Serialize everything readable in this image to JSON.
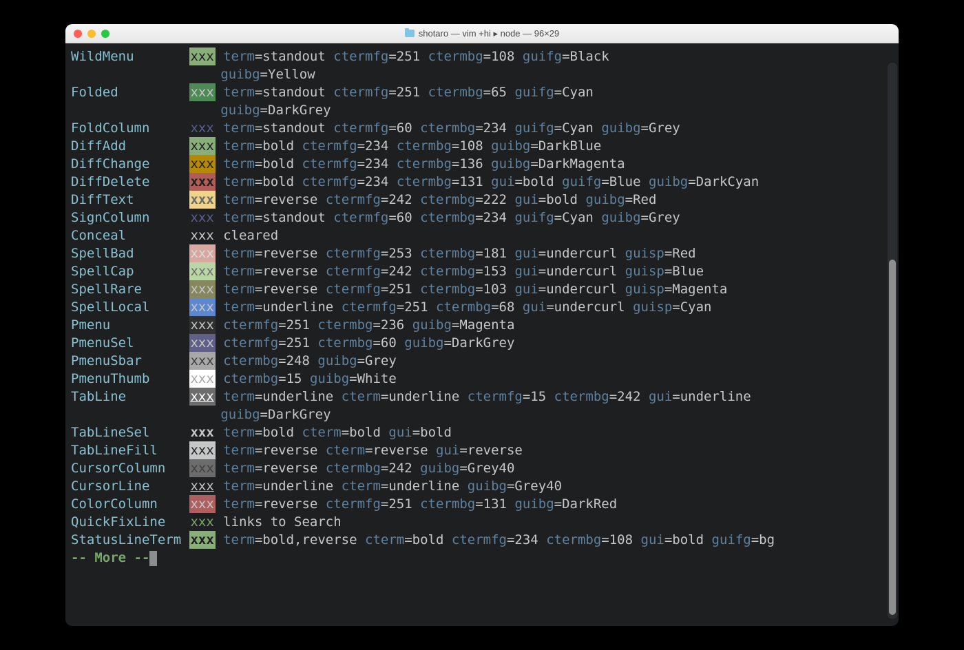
{
  "window": {
    "title": "shotaro — vim +hi ▸ node — 96×29"
  },
  "more_prompt": "-- More --",
  "pad": 14,
  "groups": [
    {
      "name": "WildMenu",
      "swatch": {
        "text": "xxx",
        "fg": "#1d1f21",
        "bg": "#8aae7a"
      },
      "attrs": [
        [
          "term",
          "standout"
        ],
        [
          "ctermfg",
          "251"
        ],
        [
          "ctermbg",
          "108"
        ],
        [
          "guifg",
          "Black"
        ]
      ],
      "continuation": [
        [
          "guibg",
          "Yellow"
        ]
      ]
    },
    {
      "name": "Folded",
      "swatch": {
        "text": "xxx",
        "fg": "#c5c8c6",
        "bg": "#4e8a55"
      },
      "attrs": [
        [
          "term",
          "standout"
        ],
        [
          "ctermfg",
          "251"
        ],
        [
          "ctermbg",
          "65"
        ],
        [
          "guifg",
          "Cyan"
        ]
      ],
      "continuation": [
        [
          "guibg",
          "DarkGrey"
        ]
      ]
    },
    {
      "name": "FoldColumn",
      "swatch": {
        "text": "xxx",
        "fg": "#5c5e8f",
        "bg": ""
      },
      "attrs": [
        [
          "term",
          "standout"
        ],
        [
          "ctermfg",
          "60"
        ],
        [
          "ctermbg",
          "234"
        ],
        [
          "guifg",
          "Cyan"
        ],
        [
          "guibg",
          "Grey"
        ]
      ]
    },
    {
      "name": "DiffAdd",
      "swatch": {
        "text": "xxx",
        "fg": "#1d1f21",
        "bg": "#8aae7a"
      },
      "attrs": [
        [
          "term",
          "bold"
        ],
        [
          "ctermfg",
          "234"
        ],
        [
          "ctermbg",
          "108"
        ],
        [
          "guibg",
          "DarkBlue"
        ]
      ]
    },
    {
      "name": "DiffChange",
      "swatch": {
        "text": "xxx",
        "fg": "#1d1f21",
        "bg": "#b58900"
      },
      "attrs": [
        [
          "term",
          "bold"
        ],
        [
          "ctermfg",
          "234"
        ],
        [
          "ctermbg",
          "136"
        ],
        [
          "guibg",
          "DarkMagenta"
        ]
      ]
    },
    {
      "name": "DiffDelete",
      "swatch": {
        "text": "xxx",
        "fg": "#1d1f21",
        "bg": "#b05c57",
        "bold": true
      },
      "attrs": [
        [
          "term",
          "bold"
        ],
        [
          "ctermfg",
          "234"
        ],
        [
          "ctermbg",
          "131"
        ],
        [
          "gui",
          "bold"
        ],
        [
          "guifg",
          "Blue"
        ],
        [
          "guibg",
          "DarkCyan"
        ]
      ]
    },
    {
      "name": "DiffText",
      "swatch": {
        "text": "xxx",
        "fg": "#6c6c6c",
        "bg": "#f0d48a",
        "bold": true
      },
      "attrs": [
        [
          "term",
          "reverse"
        ],
        [
          "ctermfg",
          "242"
        ],
        [
          "ctermbg",
          "222"
        ],
        [
          "gui",
          "bold"
        ],
        [
          "guibg",
          "Red"
        ]
      ]
    },
    {
      "name": "SignColumn",
      "swatch": {
        "text": "xxx",
        "fg": "#5c5e8f",
        "bg": ""
      },
      "attrs": [
        [
          "term",
          "standout"
        ],
        [
          "ctermfg",
          "60"
        ],
        [
          "ctermbg",
          "234"
        ],
        [
          "guifg",
          "Cyan"
        ],
        [
          "guibg",
          "Grey"
        ]
      ]
    },
    {
      "name": "Conceal",
      "swatch": {
        "text": "xxx",
        "fg": "#c5c8c6",
        "bg": ""
      },
      "plain": "cleared"
    },
    {
      "name": "SpellBad",
      "swatch": {
        "text": "xxx",
        "fg": "#dadada",
        "bg": "#d7a8a0"
      },
      "attrs": [
        [
          "term",
          "reverse"
        ],
        [
          "ctermfg",
          "253"
        ],
        [
          "ctermbg",
          "181"
        ],
        [
          "gui",
          "undercurl"
        ],
        [
          "guisp",
          "Red"
        ]
      ]
    },
    {
      "name": "SpellCap",
      "swatch": {
        "text": "xxx",
        "fg": "#6c6c6c",
        "bg": "#bad6a5"
      },
      "attrs": [
        [
          "term",
          "reverse"
        ],
        [
          "ctermfg",
          "242"
        ],
        [
          "ctermbg",
          "153"
        ],
        [
          "gui",
          "undercurl"
        ],
        [
          "guisp",
          "Blue"
        ]
      ]
    },
    {
      "name": "SpellRare",
      "swatch": {
        "text": "xxx",
        "fg": "#c5c8c6",
        "bg": "#87875f"
      },
      "attrs": [
        [
          "term",
          "reverse"
        ],
        [
          "ctermfg",
          "251"
        ],
        [
          "ctermbg",
          "103"
        ],
        [
          "gui",
          "undercurl"
        ],
        [
          "guisp",
          "Magenta"
        ]
      ]
    },
    {
      "name": "SpellLocal",
      "swatch": {
        "text": "xxx",
        "fg": "#c5c8c6",
        "bg": "#5f87d0"
      },
      "attrs": [
        [
          "term",
          "underline"
        ],
        [
          "ctermfg",
          "251"
        ],
        [
          "ctermbg",
          "68"
        ],
        [
          "gui",
          "undercurl"
        ],
        [
          "guisp",
          "Cyan"
        ]
      ]
    },
    {
      "name": "Pmenu",
      "swatch": {
        "text": "xxx",
        "fg": "#c5c8c6",
        "bg": "#303030"
      },
      "attrs": [
        [
          "ctermfg",
          "251"
        ],
        [
          "ctermbg",
          "236"
        ],
        [
          "guibg",
          "Magenta"
        ]
      ]
    },
    {
      "name": "PmenuSel",
      "swatch": {
        "text": "xxx",
        "fg": "#c5c8c6",
        "bg": "#5f5f87"
      },
      "attrs": [
        [
          "ctermfg",
          "251"
        ],
        [
          "ctermbg",
          "60"
        ],
        [
          "guibg",
          "DarkGrey"
        ]
      ]
    },
    {
      "name": "PmenuSbar",
      "swatch": {
        "text": "xxx",
        "fg": "#404040",
        "bg": "#a8a8a8"
      },
      "attrs": [
        [
          "ctermbg",
          "248"
        ],
        [
          "guibg",
          "Grey"
        ]
      ]
    },
    {
      "name": "PmenuThumb",
      "swatch": {
        "text": "xxx",
        "fg": "#a8a8a8",
        "bg": "#ffffff"
      },
      "attrs": [
        [
          "ctermbg",
          "15"
        ],
        [
          "guibg",
          "White"
        ]
      ]
    },
    {
      "name": "TabLine",
      "swatch": {
        "text": "xxx",
        "fg": "#ffffff",
        "bg": "#6c6c6c",
        "underline": true
      },
      "attrs": [
        [
          "term",
          "underline"
        ],
        [
          "cterm",
          "underline"
        ],
        [
          "ctermfg",
          "15"
        ],
        [
          "ctermbg",
          "242"
        ],
        [
          "gui",
          "underline"
        ]
      ],
      "continuation": [
        [
          "guibg",
          "DarkGrey"
        ]
      ]
    },
    {
      "name": "TabLineSel",
      "swatch": {
        "text": "xxx",
        "fg": "#c5c8c6",
        "bg": "",
        "bold": true
      },
      "attrs": [
        [
          "term",
          "bold"
        ],
        [
          "cterm",
          "bold"
        ],
        [
          "gui",
          "bold"
        ]
      ]
    },
    {
      "name": "TabLineFill",
      "swatch": {
        "text": "xxx",
        "fg": "#1d1f21",
        "bg": "#c5c8c6"
      },
      "attrs": [
        [
          "term",
          "reverse"
        ],
        [
          "cterm",
          "reverse"
        ],
        [
          "gui",
          "reverse"
        ]
      ]
    },
    {
      "name": "CursorColumn",
      "swatch": {
        "text": "xxx",
        "fg": "#404040",
        "bg": "#6c6c6c"
      },
      "attrs": [
        [
          "term",
          "reverse"
        ],
        [
          "ctermbg",
          "242"
        ],
        [
          "guibg",
          "Grey40"
        ]
      ]
    },
    {
      "name": "CursorLine",
      "swatch": {
        "text": "xxx",
        "fg": "#c5c8c6",
        "bg": "",
        "underline": true
      },
      "attrs": [
        [
          "term",
          "underline"
        ],
        [
          "cterm",
          "underline"
        ],
        [
          "guibg",
          "Grey40"
        ]
      ]
    },
    {
      "name": "ColorColumn",
      "swatch": {
        "text": "xxx",
        "fg": "#c5c8c6",
        "bg": "#af5f5f"
      },
      "attrs": [
        [
          "term",
          "reverse"
        ],
        [
          "ctermfg",
          "251"
        ],
        [
          "ctermbg",
          "131"
        ],
        [
          "guibg",
          "DarkRed"
        ]
      ]
    },
    {
      "name": "QuickFixLine",
      "swatch": {
        "text": "xxx",
        "fg": "#7aa76a",
        "bg": ""
      },
      "plain": "links to Search"
    },
    {
      "name": "StatusLineTerm",
      "swatch": {
        "text": "xxx",
        "fg": "#1d1f21",
        "bg": "#8aae7a",
        "bold": true
      },
      "attrs": [
        [
          "term",
          "bold,reverse"
        ],
        [
          "cterm",
          "bold"
        ],
        [
          "ctermfg",
          "234"
        ],
        [
          "ctermbg",
          "108"
        ],
        [
          "gui",
          "bold"
        ],
        [
          "guifg",
          "bg"
        ]
      ]
    }
  ]
}
